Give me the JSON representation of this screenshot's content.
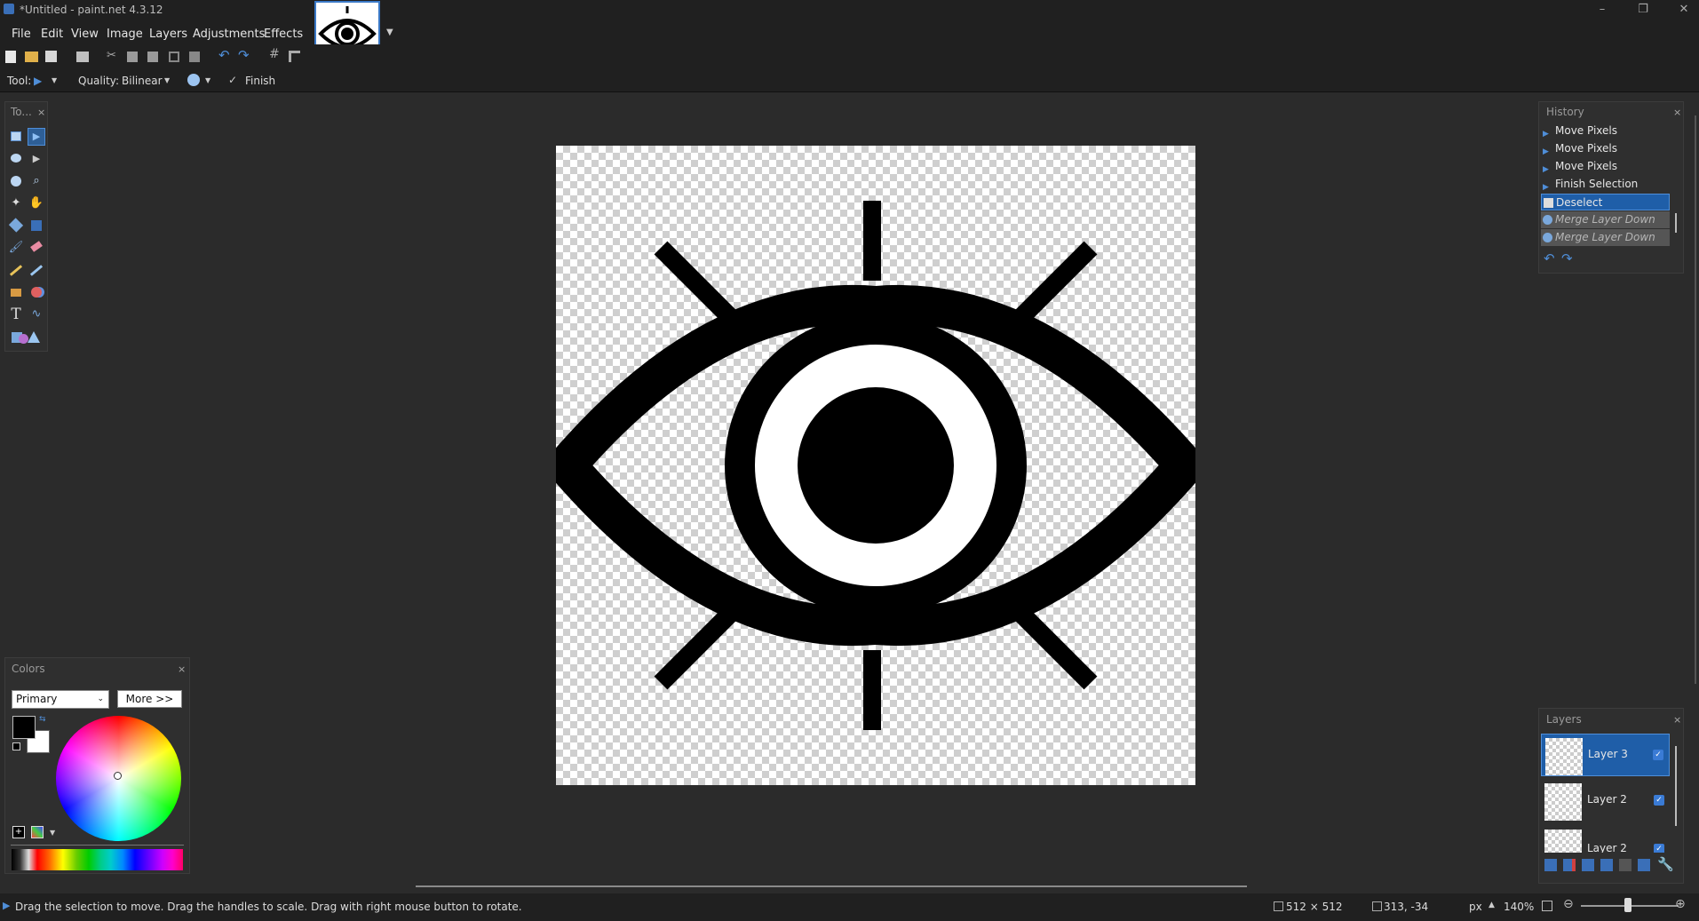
{
  "window": {
    "title": "*Untitled - paint.net 4.3.12"
  },
  "menu": [
    "File",
    "Edit",
    "View",
    "Image",
    "Layers",
    "Adjustments",
    "Effects"
  ],
  "toolbar": {
    "tool_label": "Tool:",
    "quality_label": "Quality:",
    "quality_value": "Bilinear",
    "finish_label": "Finish"
  },
  "tools_panel": {
    "title": "To..."
  },
  "history": {
    "title": "History",
    "items": [
      {
        "label": "Move Pixels",
        "state": "done"
      },
      {
        "label": "Move Pixels",
        "state": "done"
      },
      {
        "label": "Move Pixels",
        "state": "done"
      },
      {
        "label": "Finish Selection",
        "state": "done"
      },
      {
        "label": "Deselect",
        "state": "current"
      },
      {
        "label": "Merge Layer Down",
        "state": "undone"
      },
      {
        "label": "Merge Layer Down",
        "state": "undone"
      }
    ]
  },
  "layers": {
    "title": "Layers",
    "items": [
      {
        "name": "Layer 3",
        "visible": true,
        "selected": true
      },
      {
        "name": "Layer 2",
        "visible": true,
        "selected": false
      },
      {
        "name": "Layer 2",
        "visible": true,
        "selected": false
      }
    ]
  },
  "colors": {
    "title": "Colors",
    "mode": "Primary",
    "more_button": "More >>",
    "primary": "#000000",
    "secondary": "#ffffff"
  },
  "status": {
    "hint": "Drag the selection to move. Drag the handles to scale. Drag with right mouse button to rotate.",
    "image_size": "512 × 512",
    "cursor": "313, -34",
    "units": "px",
    "zoom": "140%"
  },
  "accent": "#3a78c6"
}
